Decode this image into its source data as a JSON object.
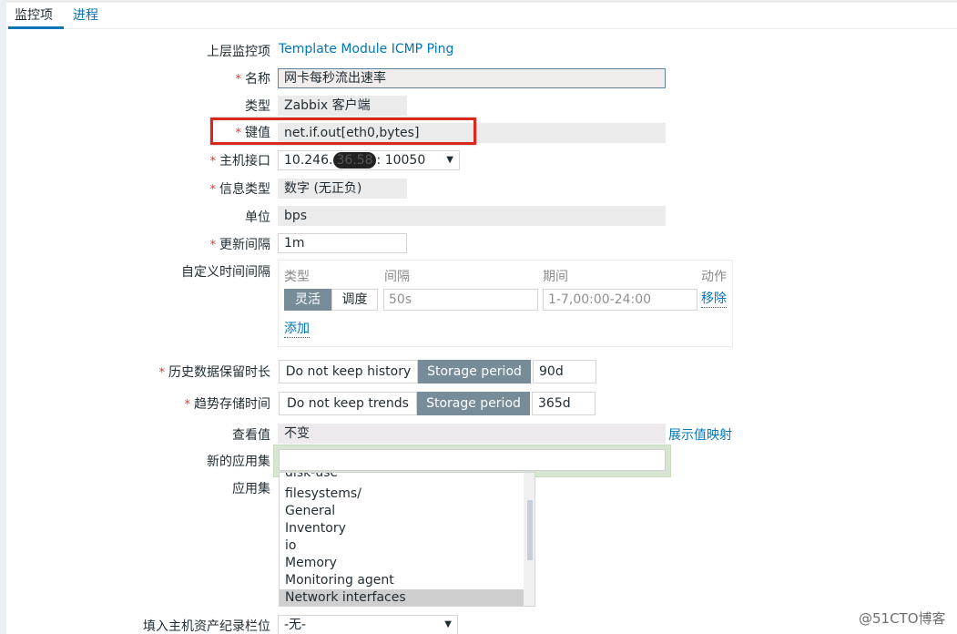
{
  "tabs": [
    {
      "label": "监控项",
      "active": true
    },
    {
      "label": "进程",
      "active": false
    }
  ],
  "form": {
    "parent": {
      "label": "上层监控项",
      "value": "Template Module ICMP Ping"
    },
    "name": {
      "label": "名称",
      "required": "*",
      "value": "网卡每秒流出速率"
    },
    "type": {
      "label": "类型",
      "value": "Zabbix 客户端"
    },
    "key": {
      "label": "键值",
      "required": "*",
      "value": "net.if.out[eth0,bytes]"
    },
    "interface": {
      "label": "主机接口",
      "required": "*",
      "prefix": "10.246.",
      "masked": "36.58",
      "suffix": ": 10050",
      "arrow": "▼"
    },
    "info_type": {
      "label": "信息类型",
      "required": "*",
      "value": "数字 (无正负)"
    },
    "units": {
      "label": "单位",
      "value": "bps"
    },
    "update_interval": {
      "label": "更新间隔",
      "required": "*",
      "value": "1m"
    },
    "custom_intervals": {
      "label": "自定义时间间隔",
      "headers": {
        "type": "类型",
        "interval": "间隔",
        "period": "期间",
        "action": "动作"
      },
      "row": {
        "type_flexible": "灵活",
        "type_scheduling": "调度",
        "interval_placeholder": "50s",
        "period_placeholder": "1-7,00:00-24:00",
        "remove": "移除"
      },
      "add": "添加"
    },
    "history": {
      "label": "历史数据保留时长",
      "required": "*",
      "off_option": "Do not keep history",
      "on_option": "Storage period",
      "value": "90d"
    },
    "trends": {
      "label": "趋势存储时间",
      "required": "*",
      "off_option": "Do not keep trends",
      "on_option": "Storage period",
      "value": "365d"
    },
    "show_value": {
      "label": "查看值",
      "value": "不变",
      "link": "展示值映射"
    },
    "new_application": {
      "label": "新的应用集",
      "value": ""
    },
    "applications": {
      "label": "应用集",
      "items": [
        {
          "label": "disk-use",
          "selected": false
        },
        {
          "label": "filesystems/",
          "selected": false
        },
        {
          "label": "General",
          "selected": false
        },
        {
          "label": "Inventory",
          "selected": false
        },
        {
          "label": "io",
          "selected": false
        },
        {
          "label": "Memory",
          "selected": false
        },
        {
          "label": "Monitoring agent",
          "selected": false
        },
        {
          "label": "Network interfaces",
          "selected": true
        }
      ]
    },
    "inventory_field": {
      "label": "填入主机资产纪录栏位",
      "value": "-无-",
      "arrow": "▼"
    }
  },
  "watermark": "@51CTO博客",
  "colors": {
    "accent": "#0275b8",
    "required": "#e33734",
    "highlight_box": "#d9281e",
    "segment_active": "#768d99"
  }
}
